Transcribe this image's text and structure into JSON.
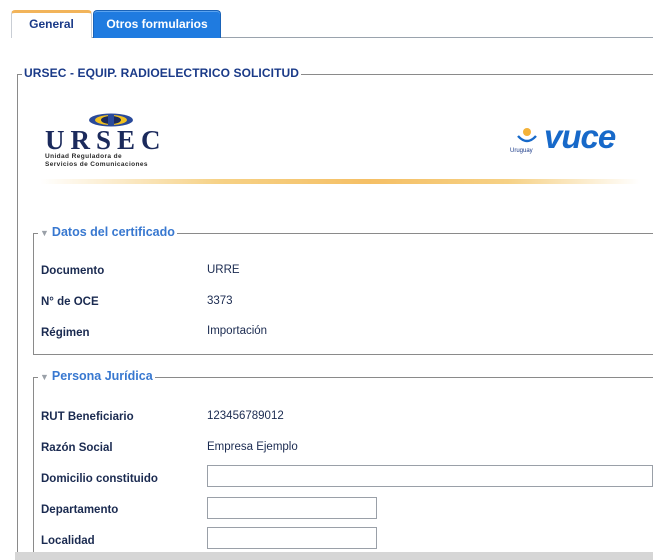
{
  "tabs": [
    {
      "label": "General",
      "active": true
    },
    {
      "label": "Otros formularios",
      "active": false
    }
  ],
  "form_title": "URSEC - EQUIP. RADIOELECTRICO SOLICITUD",
  "logos": {
    "ursec": {
      "word": "URSEC",
      "sub_line1": "Unidad Reguladora de",
      "sub_line2": "Servicios de Comunicaciones"
    },
    "vuce": {
      "word": "vuce",
      "country": "Uruguay"
    }
  },
  "sections": {
    "certificado": {
      "title": "Datos del certificado",
      "fields": [
        {
          "label": "Documento",
          "value": "URRE"
        },
        {
          "label": "N° de OCE",
          "value": "3373"
        },
        {
          "label": "Régimen",
          "value": "Importación"
        }
      ]
    },
    "persona": {
      "title": "Persona Jurídica",
      "fields": [
        {
          "label": "RUT Beneficiario",
          "value": "123456789012"
        },
        {
          "label": "Razón Social",
          "value": "Empresa Ejemplo"
        },
        {
          "label": "Domicilio constituido",
          "value": ""
        },
        {
          "label": "Departamento",
          "value": ""
        },
        {
          "label": "Localidad",
          "value": ""
        }
      ]
    }
  },
  "colors": {
    "tab_active_accent": "#f2b45a",
    "tab_inactive_bg": "#1f7be0",
    "legend_blue": "#3878d0",
    "title_navy": "#1a3a88",
    "vuce_blue": "#1769c9"
  }
}
